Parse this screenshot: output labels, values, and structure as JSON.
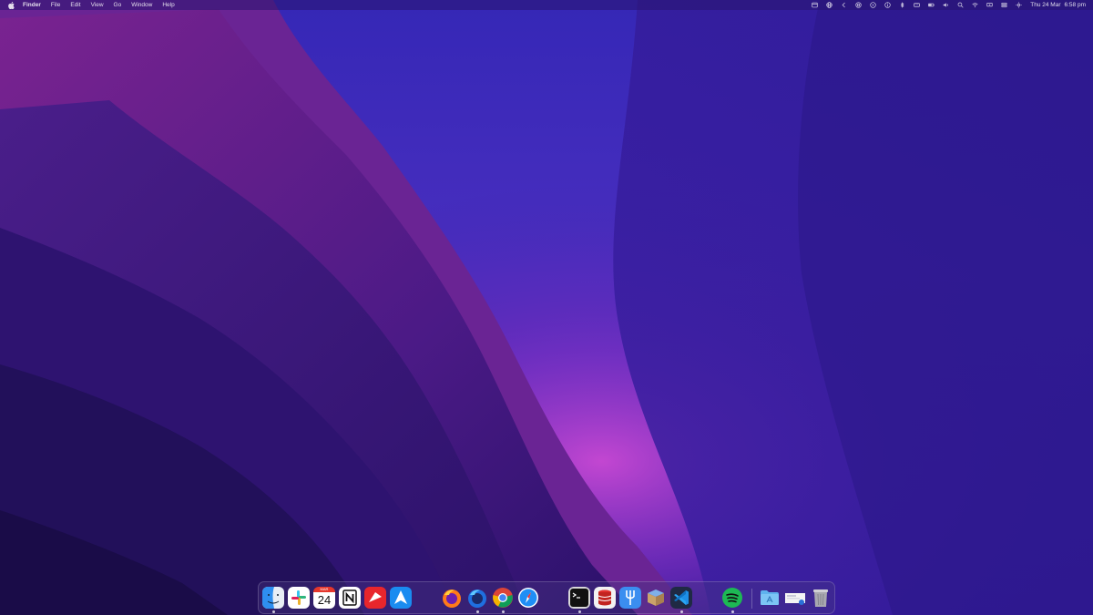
{
  "menubar": {
    "app_name": "Finder",
    "menus": [
      "File",
      "Edit",
      "View",
      "Go",
      "Window",
      "Help"
    ],
    "status_icons": [
      "calendar-icon",
      "globe-icon",
      "chevron-left-icon",
      "target-icon",
      "circle-dot-icon",
      "info-icon",
      "bluetooth-icon",
      "keyboard-icon",
      "battery-icon",
      "volume-icon",
      "search-icon",
      "wifi-icon",
      "display-icon",
      "control-center-icon",
      "brightness-icon"
    ],
    "date": "Thu 24 Mar",
    "time": "6:58 pm"
  },
  "dock": {
    "apps": [
      "finder",
      "slack",
      "calendar",
      "notion",
      "mail-app",
      "arrow-app",
      "firefox",
      "firefox-developer",
      "chrome",
      "safari",
      "terminal",
      "database-app",
      "fork",
      "archive-utility",
      "vscode",
      "spotify",
      "applications-folder",
      "downloads-stack",
      "trash"
    ],
    "calendar_month": "MAR",
    "calendar_day": "24"
  },
  "colors": {
    "accent": "#3b2bb0",
    "menubar": "#2a1a78",
    "wallpaper_top": "#3b2bb0",
    "wallpaper_glow": "#b040d0"
  }
}
